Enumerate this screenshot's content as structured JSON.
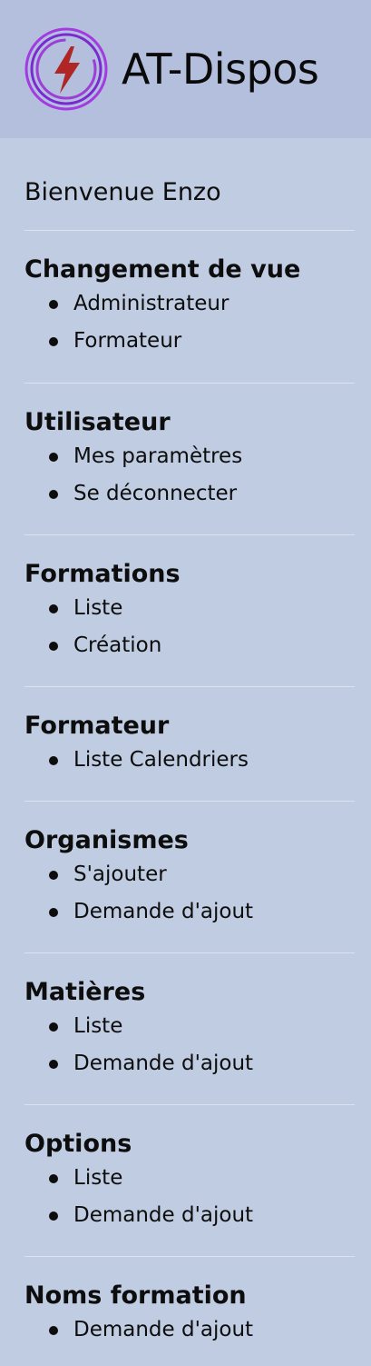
{
  "app": {
    "title": "AT-Dispos",
    "logo_icon": "lightning-bolt-icon",
    "logo_colors": {
      "ring": "#8a2be2",
      "bolt": "#b22222"
    }
  },
  "welcome": "Bienvenue Enzo",
  "sections": [
    {
      "title": "Changement de vue",
      "items": [
        "Administrateur",
        "Formateur"
      ]
    },
    {
      "title": "Utilisateur",
      "items": [
        "Mes paramètres",
        "Se déconnecter"
      ]
    },
    {
      "title": "Formations",
      "items": [
        "Liste",
        "Création"
      ]
    },
    {
      "title": "Formateur",
      "items": [
        "Liste Calendriers"
      ]
    },
    {
      "title": "Organismes",
      "items": [
        "S'ajouter",
        "Demande d'ajout"
      ]
    },
    {
      "title": "Matières",
      "items": [
        "Liste",
        "Demande d'ajout"
      ]
    },
    {
      "title": "Options",
      "items": [
        "Liste",
        "Demande d'ajout"
      ]
    },
    {
      "title": "Noms formation",
      "items": [
        "Demande d'ajout"
      ]
    }
  ]
}
